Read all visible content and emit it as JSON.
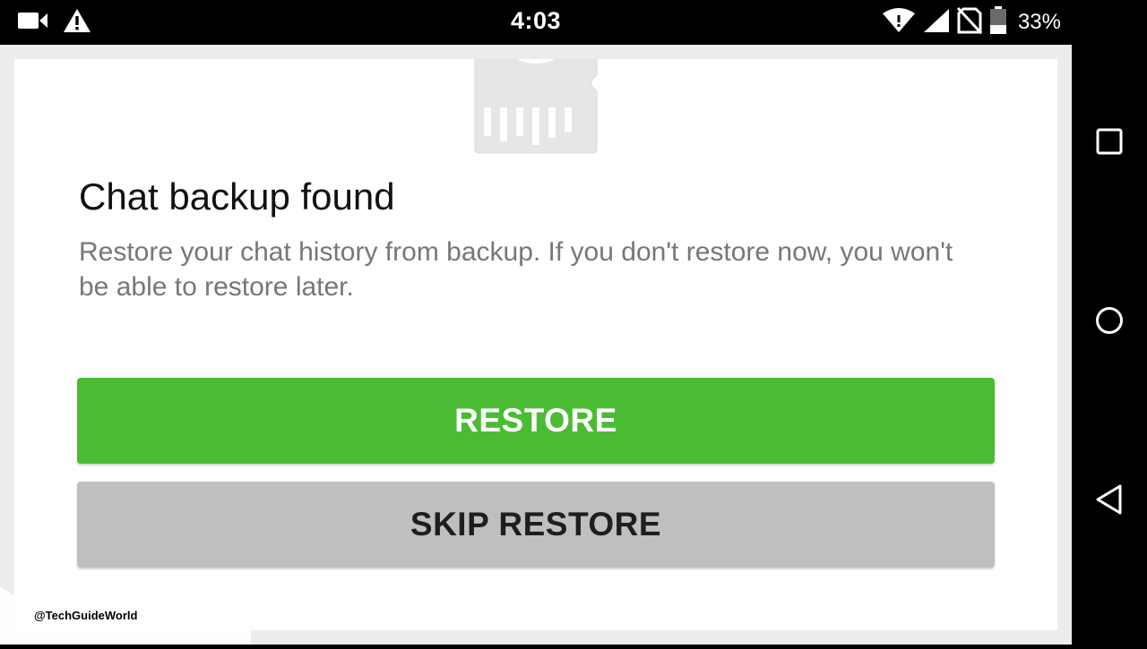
{
  "status_bar": {
    "time": "4:03",
    "battery_percent": "33%",
    "left_icons": [
      "video-camera-icon",
      "warning-icon"
    ],
    "right_icons": [
      "wifi-icon",
      "cell-signal-icon",
      "no-sim-icon",
      "battery-icon"
    ]
  },
  "dialog": {
    "title": "Chat backup found",
    "description": "Restore your chat history from backup. If you don't restore now, you won't be able to restore later.",
    "restore_label": "RESTORE",
    "skip_label": "SKIP RESTORE",
    "illustration": "sd-card-icon"
  },
  "watermark": {
    "text": "@TechGuideWorld"
  },
  "nav_bar": {
    "buttons": [
      "recents-button",
      "home-button",
      "back-button"
    ]
  },
  "colors": {
    "restore_button": "#4cbb34",
    "skip_button": "#bfbfbf",
    "title_text": "#111111",
    "description_text": "#777777",
    "background": "#ececec"
  }
}
